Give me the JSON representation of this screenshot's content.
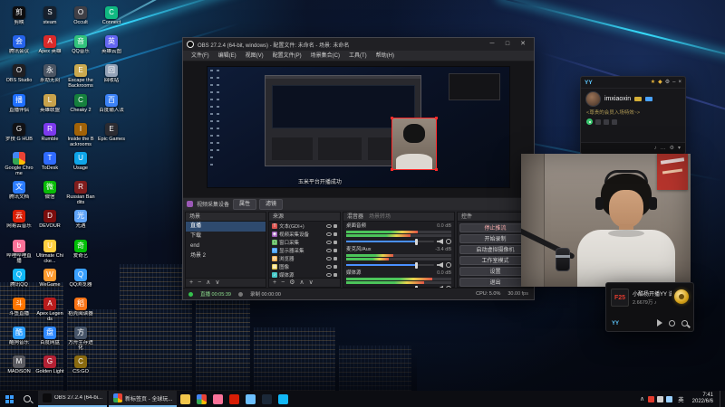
{
  "desktop": {
    "icons": [
      {
        "label": "剪映",
        "color": "#0d0d0f",
        "glyph": "剪"
      },
      {
        "label": "腾讯会议",
        "color": "#2563eb",
        "glyph": "会"
      },
      {
        "label": "OBS Studio",
        "color": "#1f1f23",
        "glyph": "O"
      },
      {
        "label": "直播伴侣",
        "color": "#1e6fff",
        "glyph": "播"
      },
      {
        "label": "罗技 G HUB",
        "color": "#111114",
        "glyph": "G"
      },
      {
        "label": "Google Chrome",
        "color": "conic-gradient(#ea4335 0 120deg,#fbbc05 120deg 180deg,#34a853 180deg 270deg,#4285f4 270deg 360deg)",
        "glyph": ""
      },
      {
        "label": "腾讯文档",
        "color": "#2b7cff",
        "glyph": "文"
      },
      {
        "label": "网易云音乐",
        "color": "#d81e06",
        "glyph": "云"
      },
      {
        "label": "哔哩哔哩直播",
        "color": "#fb7299",
        "glyph": "b"
      },
      {
        "label": "腾讯QQ",
        "color": "#12b7f5",
        "glyph": "Q"
      },
      {
        "label": "斗鱼直播",
        "color": "#ff7500",
        "glyph": "斗"
      },
      {
        "label": "酷狗音乐",
        "color": "#2c9eff",
        "glyph": "酷"
      },
      {
        "label": "MADiSON",
        "color": "#5a5a60",
        "glyph": "M"
      },
      {
        "label": "steam",
        "color": "#16202d",
        "glyph": "S"
      },
      {
        "label": "Apex 英雄",
        "color": "#da2a2a",
        "glyph": "A"
      },
      {
        "label": "永劫无间",
        "color": "#4b5563",
        "glyph": "永"
      },
      {
        "label": "英雄联盟",
        "color": "#c8a24b",
        "glyph": "L"
      },
      {
        "label": "Rumble",
        "color": "#7c3aed",
        "glyph": "R"
      },
      {
        "label": "ToDesk",
        "color": "#2f6bff",
        "glyph": "T"
      },
      {
        "label": "微信",
        "color": "#09bb07",
        "glyph": "微"
      },
      {
        "label": "DEVOUR",
        "color": "#7a0d0d",
        "glyph": "D"
      },
      {
        "label": "Ultimate Chicke...",
        "color": "#ffcf3f",
        "glyph": "U"
      },
      {
        "label": "WeGame",
        "color": "#ff9a2e",
        "glyph": "W"
      },
      {
        "label": "Apex Legends",
        "color": "#b91c1c",
        "glyph": "A"
      },
      {
        "label": "百度网盘",
        "color": "#2f88ff",
        "glyph": "盘"
      },
      {
        "label": "Golden Light",
        "color": "#b32134",
        "glyph": "G"
      },
      {
        "label": "Occult",
        "color": "#3f3f46",
        "glyph": "O"
      },
      {
        "label": "QQ音乐",
        "color": "#31c27c",
        "glyph": "音"
      },
      {
        "label": "Escape the Backrooms",
        "color": "#caa94f",
        "glyph": "E"
      },
      {
        "label": "Cheaky 2",
        "color": "#15803d",
        "glyph": "C"
      },
      {
        "label": "Inside the Backrooms",
        "color": "#a16207",
        "glyph": "I"
      },
      {
        "label": "Usage",
        "color": "#0ea5e9",
        "glyph": "U"
      },
      {
        "label": "Russian Bandits",
        "color": "#7f1d1d",
        "glyph": "R"
      },
      {
        "label": "光遇",
        "color": "#60a5fa",
        "glyph": "光"
      },
      {
        "label": "爱奇艺",
        "color": "#00be06",
        "glyph": "奇"
      },
      {
        "label": "QQ浏览器",
        "color": "#3aa0ff",
        "glyph": "Q"
      },
      {
        "label": "稻壳阅读器",
        "color": "#f97316",
        "glyph": "稻"
      },
      {
        "label": "方舟生存进化",
        "color": "#475569",
        "glyph": "方"
      },
      {
        "label": "CS:GO",
        "color": "#8a6a10",
        "glyph": "C"
      },
      {
        "label": "Connect",
        "color": "#10b981",
        "glyph": "C"
      },
      {
        "label": "英雄云图",
        "color": "#6366f1",
        "glyph": "英"
      },
      {
        "label": "回收站",
        "color": "#94a3b8",
        "glyph": "回"
      },
      {
        "label": "百度输入法",
        "color": "#3b82f6",
        "glyph": "百"
      },
      {
        "label": "Epic Games",
        "color": "#2b2b31",
        "glyph": "E"
      }
    ]
  },
  "obs": {
    "title": "OBS 27.2.4 (64-bit, windows) - 配置文件: 未命名 - 场景: 未命名",
    "window_buttons": {
      "minimize": "─",
      "maximize": "□",
      "close": "✕"
    },
    "menus": [
      "文件(F)",
      "编辑(E)",
      "视图(V)",
      "配置文件(P)",
      "场景集合(C)",
      "工具(T)",
      "帮助(H)"
    ],
    "preview": {
      "toast": "玉米平台开播成功"
    },
    "context_bar": {
      "source_label": "视频采集设备",
      "buttons": [
        "属性",
        "滤镜"
      ]
    },
    "scenes": {
      "header": "场景",
      "items": [
        "直播",
        "下载",
        "end",
        "场景 2"
      ],
      "selected_index": 0,
      "toolbar": [
        {
          "name": "add-scene-icon",
          "glyph": "+"
        },
        {
          "name": "remove-scene-icon",
          "glyph": "−"
        },
        {
          "name": "scene-up-icon",
          "glyph": "∧"
        },
        {
          "name": "scene-down-icon",
          "glyph": "∨"
        }
      ]
    },
    "sources": {
      "header": "来源",
      "items": [
        {
          "name": "文本(GDI+)",
          "glyph": "T",
          "color": "#d9534f"
        },
        {
          "name": "视频采集设备",
          "glyph": "◉",
          "color": "#9b59b6"
        },
        {
          "name": "窗口采集",
          "glyph": "▢",
          "color": "#5cb85c"
        },
        {
          "name": "显示器采集",
          "glyph": "▭",
          "color": "#4aa3ff"
        },
        {
          "name": "浏览器",
          "glyph": "◍",
          "color": "#f0ad4e"
        },
        {
          "name": "图像",
          "glyph": "▦",
          "color": "#e8c84b"
        },
        {
          "name": "媒体源",
          "glyph": "♪",
          "color": "#46c8c8"
        }
      ],
      "toolbar": [
        {
          "name": "add-source-icon",
          "glyph": "+"
        },
        {
          "name": "remove-source-icon",
          "glyph": "−"
        },
        {
          "name": "source-properties-icon",
          "glyph": "⚙"
        },
        {
          "name": "source-up-icon",
          "glyph": "∧"
        },
        {
          "name": "source-down-icon",
          "glyph": "∨"
        }
      ]
    },
    "mixer": {
      "tabs": [
        "混音器",
        "场景转场"
      ],
      "channels": [
        {
          "name": "桌面音频",
          "db": "0.0 dB",
          "level": 0.68
        },
        {
          "name": "麦克风/Aux",
          "db": "-3.4 dB",
          "level": 0.45
        },
        {
          "name": "媒体源",
          "db": "0.0 dB",
          "level": 0.82
        }
      ]
    },
    "controls": {
      "header": "控件",
      "buttons": [
        "停止推流",
        "开始录制",
        "启动虚拟摄像机",
        "工作室模式",
        "设置",
        "退出"
      ]
    },
    "statusbar": {
      "live": "直播 00:05:39",
      "rec": "录制 00:00:00",
      "cpu": "CPU: 5.0%",
      "fps": "30.00 fps"
    }
  },
  "yy": {
    "logo": "YY",
    "top_icons": [
      {
        "name": "privilege-icon",
        "glyph": "★",
        "color": "#e7b43c"
      },
      {
        "name": "gift-icon",
        "glyph": "◆",
        "color": "#e7b43c"
      },
      {
        "name": "settings-icon",
        "glyph": "⚙",
        "color": "#bbbbbb"
      },
      {
        "name": "minimize-icon",
        "glyph": "–",
        "color": "#bbbbbb"
      },
      {
        "name": "close-icon",
        "glyph": "×",
        "color": "#bbbbbb"
      }
    ],
    "user": "imxiaoxin",
    "message": "<尊贵的会员入场特效~>",
    "bottom_icons": [
      {
        "name": "voice-icon",
        "glyph": "♪"
      },
      {
        "name": "chat-icon",
        "glyph": "…"
      },
      {
        "name": "settings-icon",
        "glyph": "⚙"
      },
      {
        "name": "expand-icon",
        "glyph": "▾"
      }
    ]
  },
  "player": {
    "logo": "F25",
    "yy_mark": "YY",
    "title": "小酷杨开播YY 说说...",
    "count": "2.6679万 ♪"
  },
  "taskbar": {
    "tasks": [
      {
        "label": "OBS 27.2.4 (64-bi...",
        "color": "#0b0b0d"
      },
      {
        "label": "新标签页 - 全球玩...",
        "color": "conic-gradient(#ea4335 0 120deg,#fbbc05 120deg 180deg,#34a853 180deg 270deg,#4285f4 270deg 360deg)"
      }
    ],
    "quick_icons": [
      {
        "name": "explorer-icon",
        "color": "#f3c64b"
      },
      {
        "name": "chrome-icon",
        "color": "conic-gradient(#ea4335 0 120deg,#fbbc05 120deg 180deg,#34a853 180deg 270deg,#4285f4 270deg 360deg)"
      },
      {
        "name": "bilibili-icon",
        "color": "#fb7299"
      },
      {
        "name": "netease-music-icon",
        "color": "#d81e06"
      },
      {
        "name": "yy-icon",
        "color": "#6cc0ff"
      },
      {
        "name": "steam-icon",
        "color": "#1b2838"
      },
      {
        "name": "qq-icon",
        "color": "#12b7f5"
      }
    ],
    "tray": {
      "chevron": "∧",
      "lang": "英",
      "time": "7:41",
      "date": "2022/6/6",
      "icons": [
        {
          "name": "tray-app-red-icon",
          "color": "#e23b2e"
        },
        {
          "name": "network-icon",
          "color": "#cfcfcf"
        },
        {
          "name": "volume-icon",
          "color": "#9ad0ff"
        }
      ]
    }
  }
}
